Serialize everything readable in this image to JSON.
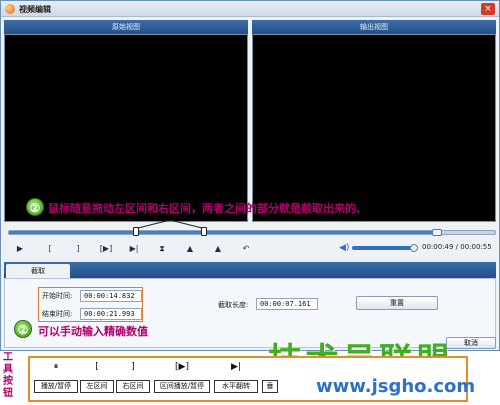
{
  "window": {
    "title": "视频编辑",
    "close_glyph": "×"
  },
  "views": {
    "left_title": "原始视图",
    "right_title": "输出视图"
  },
  "annotations": {
    "badge1": "②",
    "text1": "鼠标随意拖动左区间和右区间，两者之间的部分就是截取出来的、",
    "badge2": "②",
    "text2": "可以手动输入精确数值"
  },
  "timeline": {
    "progress": 0.88
  },
  "controls": {
    "play": "▶",
    "left_bracket": "[",
    "right_bracket": "]",
    "play_range": "[▶]",
    "next_frame": "▶|",
    "x_icon": "⧗",
    "mirror1": "▲",
    "mirror2": "▲",
    "undo": "↶"
  },
  "volume": {
    "level": 0.9,
    "icon": "◀)"
  },
  "time": {
    "current": "00:00:49",
    "separator": " / ",
    "total": "00:00:55"
  },
  "tab": {
    "label": "截取"
  },
  "fields": {
    "start_label": "开始时间:",
    "start_value": "00:00:14.832",
    "end_label": "结束时间:",
    "end_value": "00:00:21.993",
    "length_label": "截取长度:",
    "length_value": "00:00:07.161"
  },
  "buttons": {
    "reset": "重置",
    "cancel": "取消"
  },
  "legend": {
    "side_text": "工具按钮",
    "tools": [
      {
        "icon": "⏸",
        "label": "播放/暂停"
      },
      {
        "icon": "[",
        "label": "左区间"
      },
      {
        "icon": "]",
        "label": "右区间"
      },
      {
        "icon": "[▶]",
        "label": "区间播放/暂停"
      },
      {
        "icon": "▶|",
        "label": "水平翻转"
      },
      {
        "icon": "",
        "label": "垂"
      }
    ]
  },
  "watermark": {
    "text": "技术员联盟",
    "url": "www.jsgho.com"
  }
}
